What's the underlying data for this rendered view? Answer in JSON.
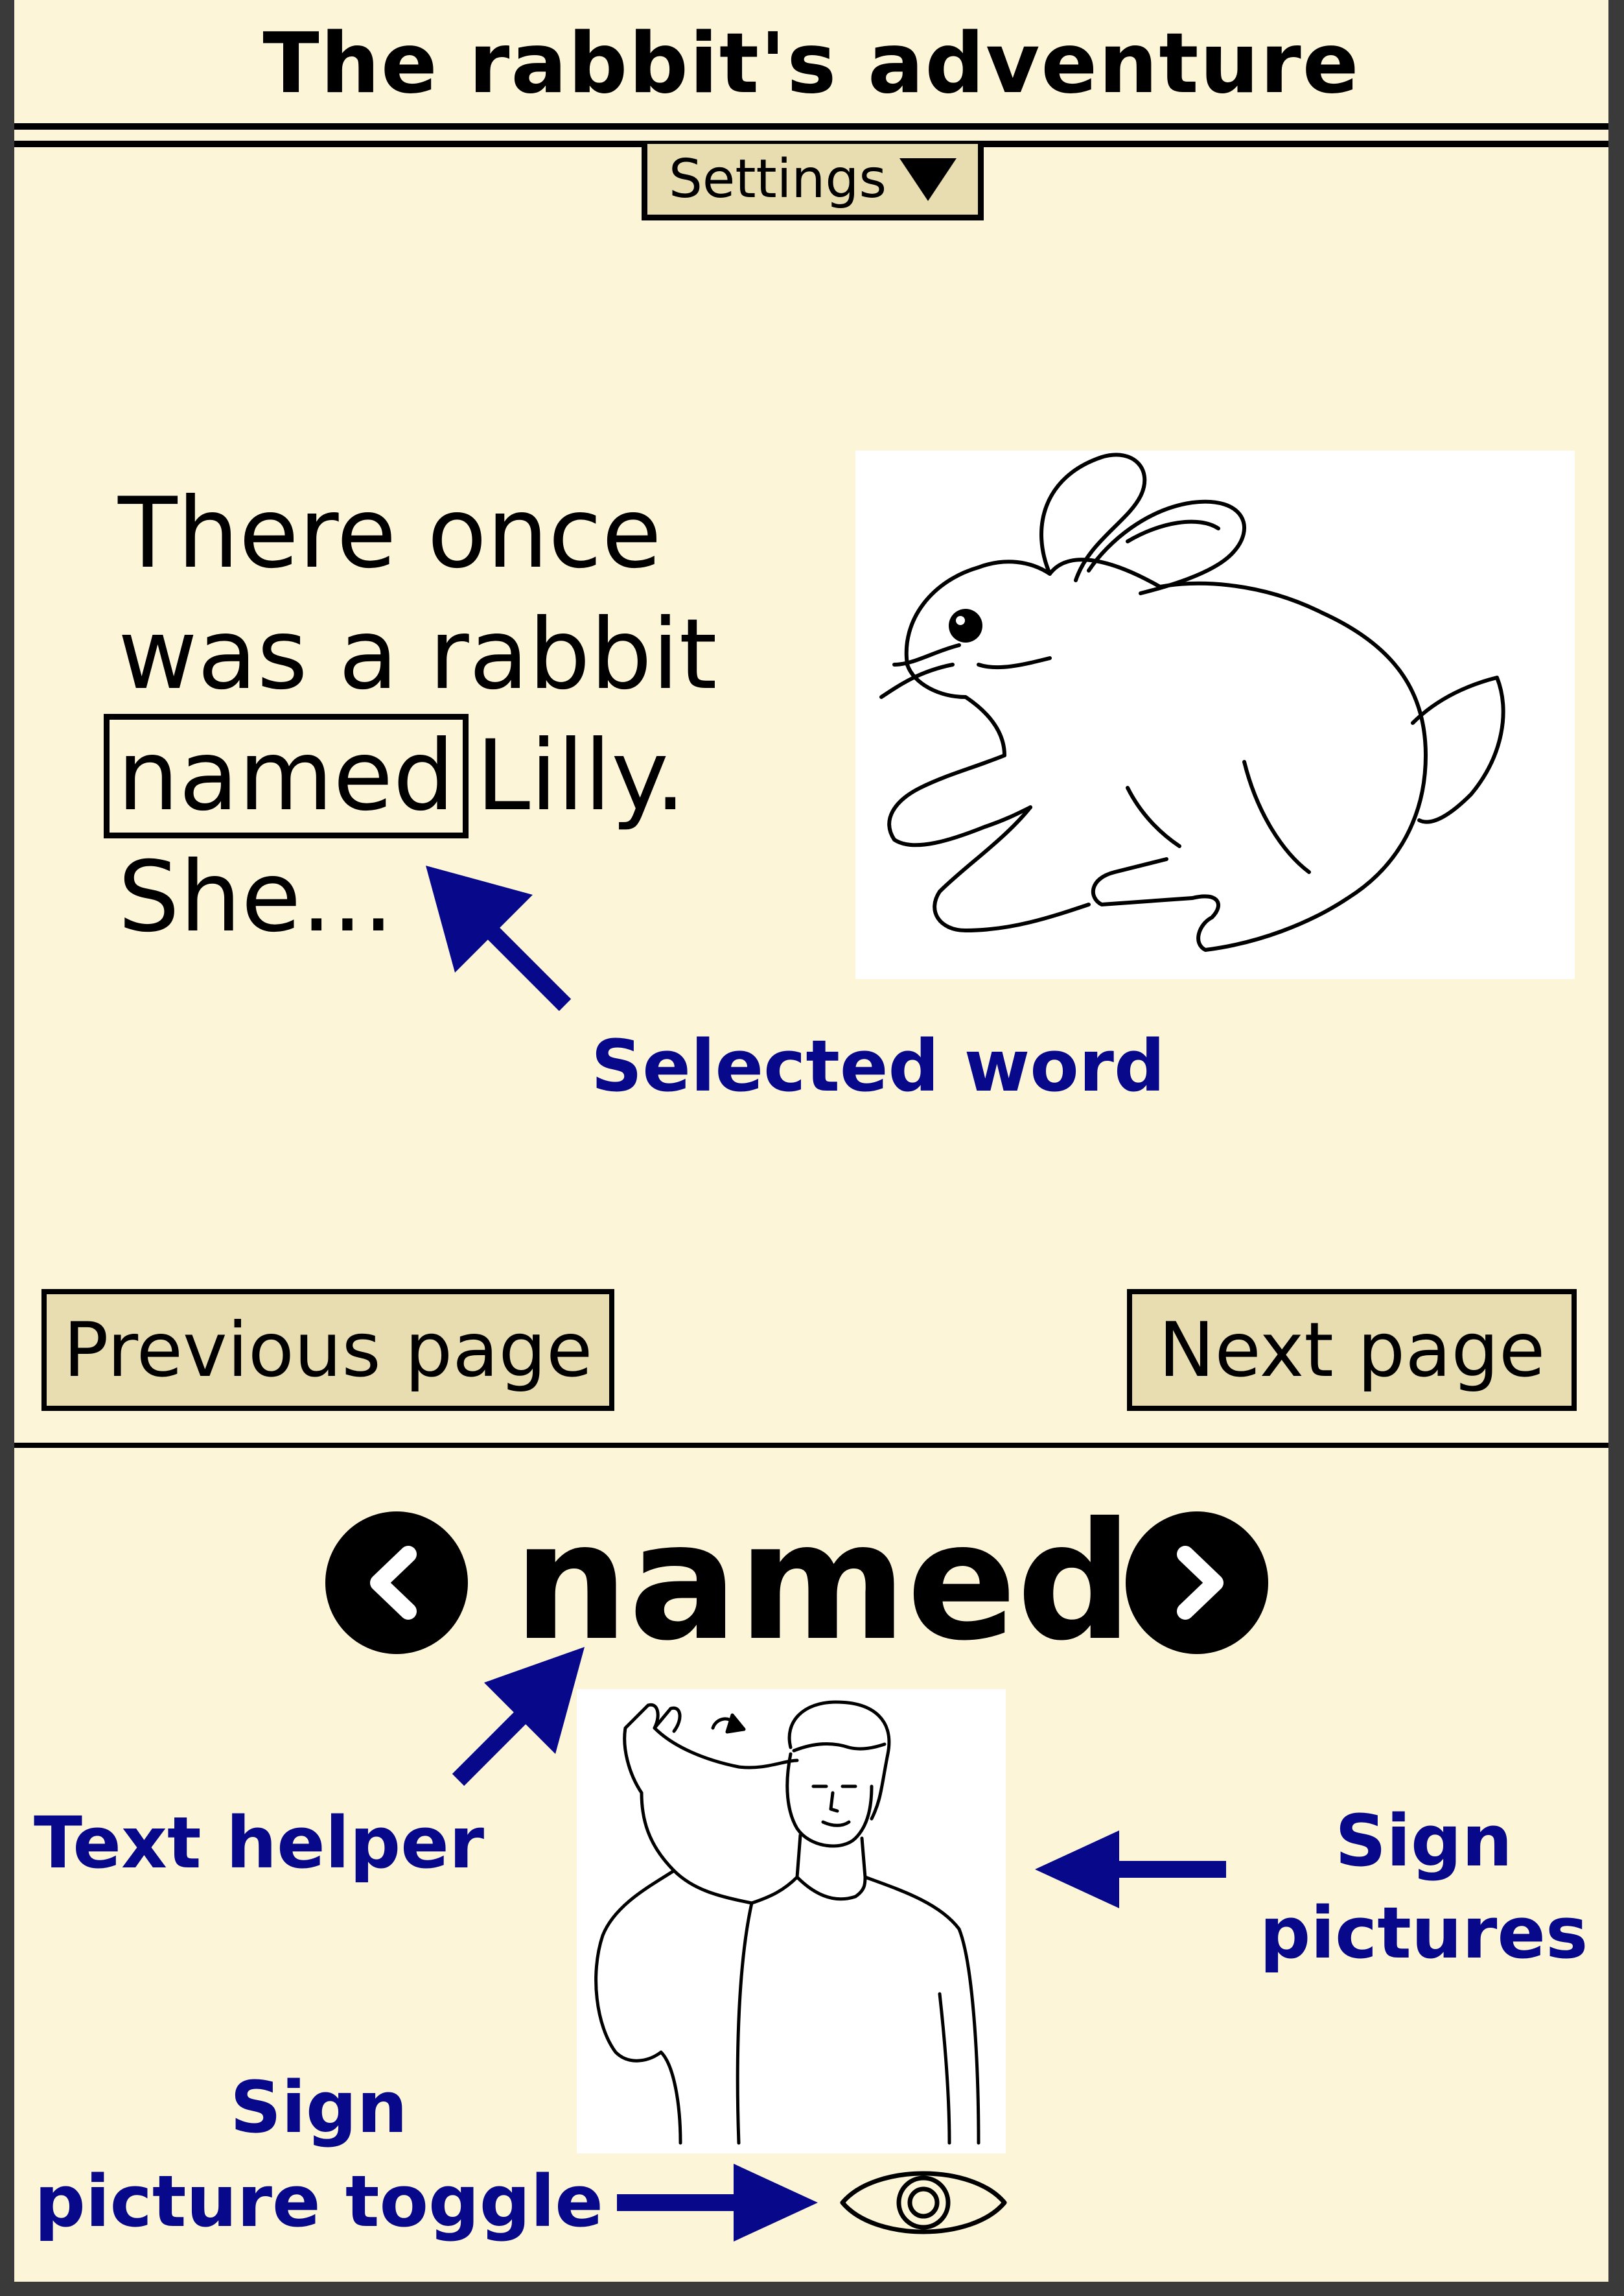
{
  "app": {
    "title": "The rabbit's adventure"
  },
  "settings": {
    "label": "Settings",
    "icon": "caret-down-icon"
  },
  "story": {
    "lines": [
      "There once",
      "was a rabbit",
      "Lilly.",
      "She..."
    ],
    "selected_word": "named"
  },
  "navigation": {
    "previous_label": "Previous page",
    "next_label": "Next page"
  },
  "helper": {
    "word": "named",
    "prev_icon": "chevron-left-icon",
    "next_icon": "chevron-right-icon",
    "toggle_icon": "eye-icon"
  },
  "annotations": {
    "selected_word": "Selected word",
    "text_helper": "Text helper",
    "sign_pictures": "Sign pictures",
    "sign_picture_toggle_line1": "Sign",
    "sign_picture_toggle_line2": "picture toggle"
  },
  "colors": {
    "background": "#fdf5d7",
    "button": "#e8ddb1",
    "annotation": "#07098a",
    "frame": "#3a3a3a"
  }
}
